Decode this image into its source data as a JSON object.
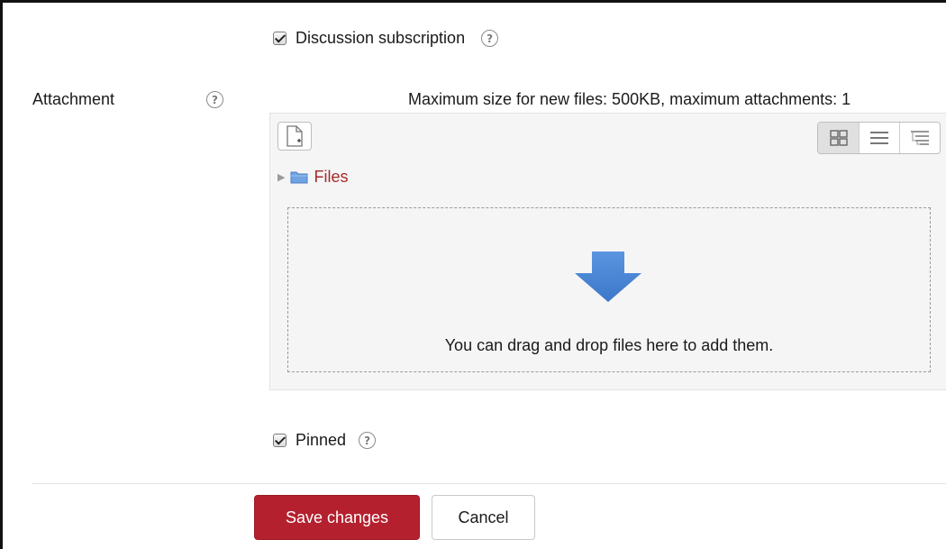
{
  "subscription": {
    "label": "Discussion subscription",
    "checked": true,
    "help_glyph": "?"
  },
  "attachment": {
    "label": "Attachment",
    "help_glyph": "?",
    "max_size_text": "Maximum size for new files: 500KB, maximum attachments: 1"
  },
  "filemanager": {
    "folder_label": "Files",
    "drop_text": "You can drag and drop files here to add them.",
    "icons": {
      "add": "add-file-icon",
      "view_icons": "grid-view-icon",
      "view_list": "list-view-icon",
      "view_tree": "tree-view-icon",
      "folder": "folder-icon",
      "drop": "down-arrow-icon"
    }
  },
  "pinned": {
    "label": "Pinned",
    "checked": true,
    "help_glyph": "?"
  },
  "actions": {
    "save_label": "Save changes",
    "cancel_label": "Cancel"
  },
  "colors": {
    "primary": "#b5202e",
    "link": "#a52a2a",
    "drop_arrow": "#4a86d8"
  }
}
